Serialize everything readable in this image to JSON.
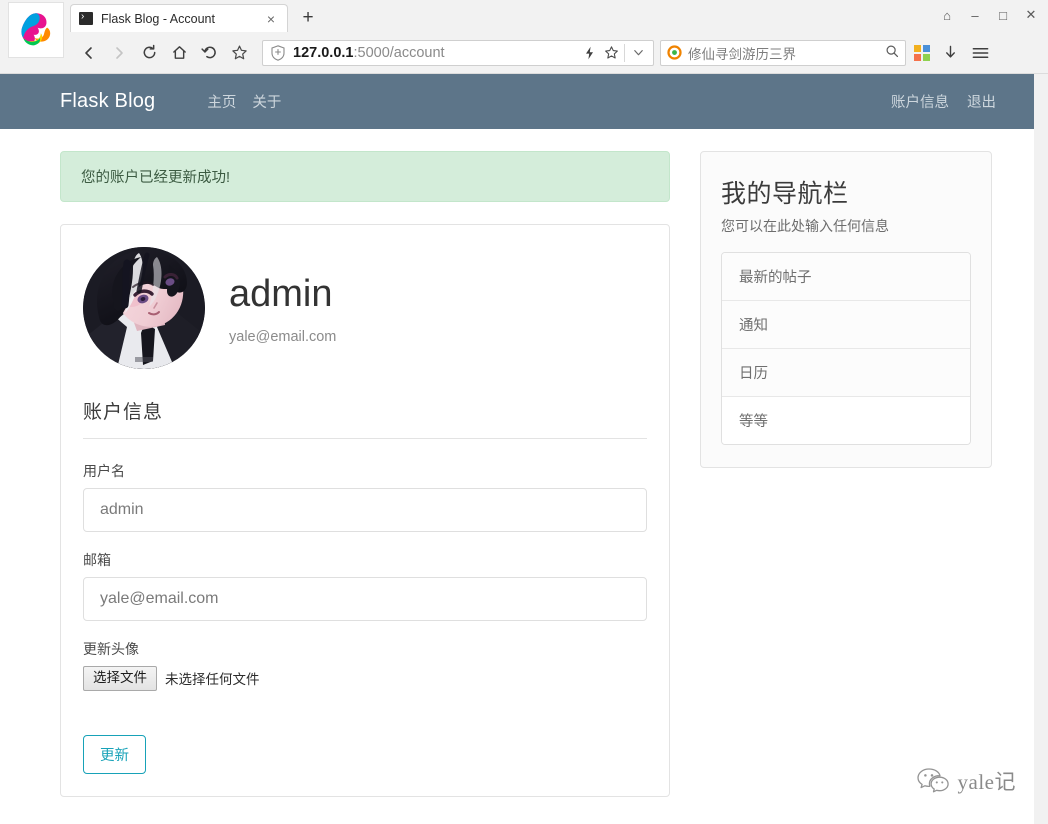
{
  "browser": {
    "tab": {
      "title": "Flask Blog - Account",
      "favicon": "terminal-icon",
      "close_label": "×"
    },
    "new_tab_label": "+",
    "window_controls": {
      "restore": "⌂",
      "minimize": "–",
      "maximize": "□",
      "close": "✕"
    },
    "toolbar": {
      "back": "‹",
      "forward": "›",
      "reload": "↻",
      "home": "⌂",
      "history": "↶",
      "bookmark": "☆"
    },
    "url": {
      "host": "127.0.0.1",
      "path": ":5000/account",
      "full": "127.0.0.1:5000/account",
      "shield_icon": "shield-plus-icon",
      "lightning_icon": "lightning-icon",
      "star_icon": "star-icon",
      "chevron_icon": "chevron-down-icon"
    },
    "search": {
      "value": "修仙寻剑游历三界",
      "engine_icon": "search-engine-icon",
      "go_icon": "search-icon"
    },
    "extensions": {
      "apps_icon": "apps-grid-icon",
      "downloads_icon": "download-arrow-icon",
      "menu_icon": "hamburger-menu-icon"
    }
  },
  "site": {
    "brand": "Flask Blog",
    "nav_left": [
      {
        "label": "主页"
      },
      {
        "label": "关于"
      }
    ],
    "nav_right": [
      {
        "label": "账户信息"
      },
      {
        "label": "退出"
      }
    ],
    "navbar_color": "#5d7589"
  },
  "main": {
    "alert": {
      "message": "您的账户已经更新成功!",
      "bg_color": "#d4edda",
      "border_color": "#c3e6cb"
    },
    "profile": {
      "avatar_alt": "user-avatar",
      "username": "admin",
      "email": "yale@email.com"
    },
    "form": {
      "legend": "账户信息",
      "fields": [
        {
          "label": "用户名",
          "value": "admin",
          "name": "username-input"
        },
        {
          "label": "邮箱",
          "value": "yale@email.com",
          "name": "email-input"
        }
      ],
      "file": {
        "label": "更新头像",
        "button": "选择文件",
        "status": "未选择任何文件"
      },
      "submit": "更新",
      "submit_color": "#17a2b8"
    }
  },
  "sidebar": {
    "title": "我的导航栏",
    "subtitle": "您可以在此处输入任何信息",
    "items": [
      {
        "label": "最新的帖子"
      },
      {
        "label": "通知"
      },
      {
        "label": "日历"
      },
      {
        "label": "等等"
      }
    ]
  },
  "watermark": {
    "text": "yale记",
    "icon": "wechat-icon"
  }
}
